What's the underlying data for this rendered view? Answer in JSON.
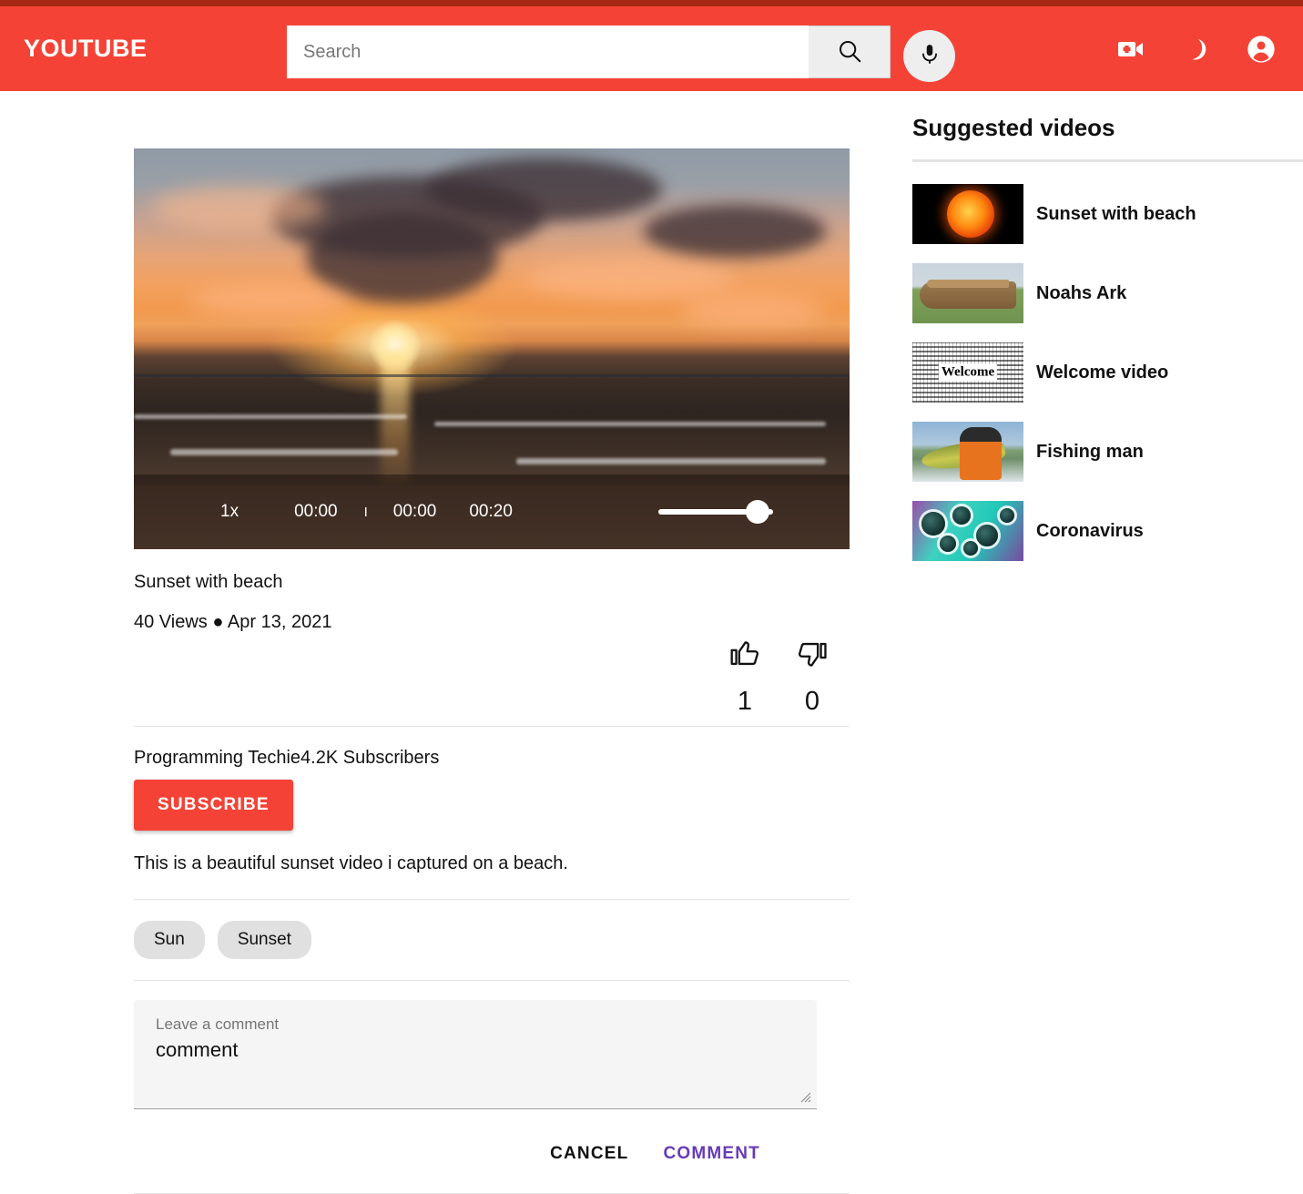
{
  "header": {
    "brand": "YOUTUBE",
    "search": {
      "placeholder": "Search",
      "value": ""
    },
    "icons": {
      "search": "search-icon",
      "mic": "microphone-icon",
      "upload": "video-camera-plus-icon",
      "theme": "moon-icon",
      "account": "account-circle-icon"
    }
  },
  "player": {
    "speed": "1x",
    "current_time": "00:00",
    "tick": "I",
    "elapsed": "00:00",
    "duration": "00:20",
    "volume_percent": 82
  },
  "video": {
    "title": "Sunset with beach",
    "views": "40 Views",
    "separator": "●",
    "date": "Apr 13, 2021",
    "likes": "1",
    "dislikes": "0",
    "channel": "Programming Techie4.2K Subscribers",
    "subscribe_label": "SUBSCRIBE",
    "description": "This is a beautiful sunset video i captured on a beach.",
    "tags": [
      "Sun",
      "Sunset"
    ]
  },
  "comment": {
    "label": "Leave a comment",
    "value": "comment",
    "cancel_label": "CANCEL",
    "submit_label": "COMMENT"
  },
  "sidebar": {
    "title": "Suggested videos",
    "items": [
      {
        "label": "Sunset with beach",
        "thumb": "sun-thumbnail"
      },
      {
        "label": "Noahs Ark",
        "thumb": "ark-thumbnail"
      },
      {
        "label": "Welcome video",
        "thumb": "welcome-wordcloud-thumbnail"
      },
      {
        "label": "Fishing man",
        "thumb": "fishing-thumbnail"
      },
      {
        "label": "Coronavirus",
        "thumb": "coronavirus-thumbnail"
      }
    ]
  },
  "colors": {
    "header_red": "#f44336",
    "header_dark_red": "#a52714",
    "accent_purple": "#673ab7",
    "chip_gray": "#e0e0e0"
  }
}
